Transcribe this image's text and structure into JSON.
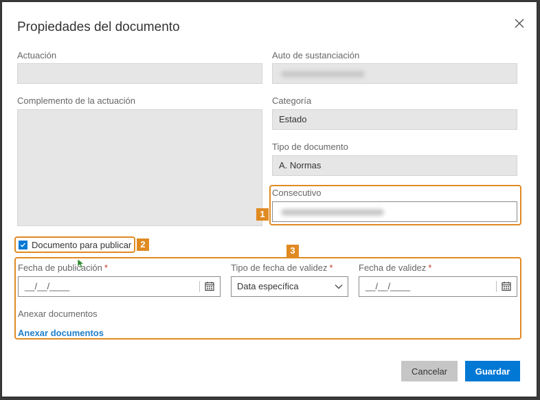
{
  "dialog": {
    "title": "Propiedades del documento",
    "close_icon": "close-icon"
  },
  "fields": {
    "actuacion_label": "Actuación",
    "auto_label": "Auto de sustanciación",
    "complemento_label": "Complemento de la actuación",
    "categoria_label": "Categoría",
    "categoria_value": "Estado",
    "tipo_doc_label": "Tipo de documento",
    "tipo_doc_value": "A. Normas",
    "consecutivo_label": "Consecutivo"
  },
  "publish": {
    "checkbox_label": "Documento para publicar",
    "checked": true
  },
  "dates": {
    "fecha_pub_label": "Fecha de publicación",
    "fecha_pub_value": "__/__/____",
    "tipo_fecha_label": "Tipo de fecha de validez",
    "tipo_fecha_value": "Data específica",
    "fecha_val_label": "Fecha de validez",
    "fecha_val_value": "__/__/____",
    "required_mark": "*"
  },
  "attachments": {
    "section_label": "Anexar documentos",
    "link_label": "Anexar documentos"
  },
  "buttons": {
    "cancel_label": "Cancelar",
    "save_label": "Guardar"
  },
  "annotations": {
    "badge_1": "1",
    "badge_2": "2",
    "badge_3": "3"
  },
  "colors": {
    "accent": "#0078d4",
    "highlight": "#e08a22",
    "link": "#1e7ec8",
    "required": "#c0392b"
  }
}
